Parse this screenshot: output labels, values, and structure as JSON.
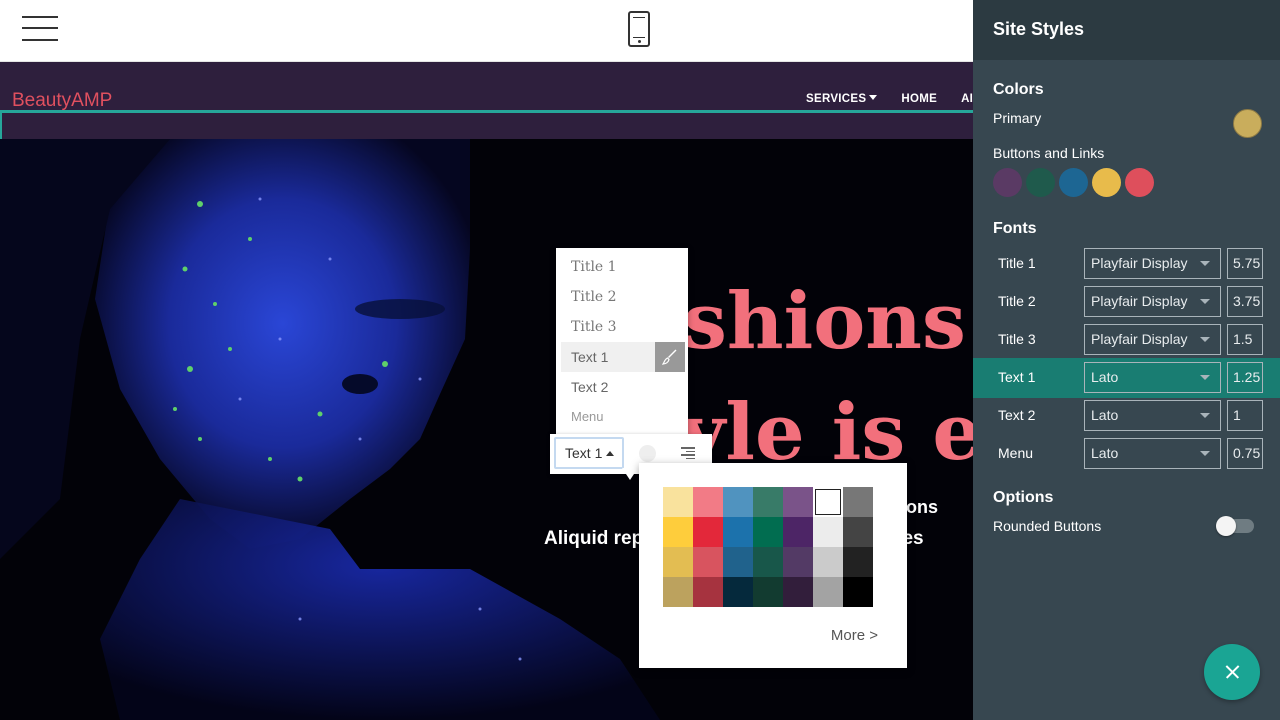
{
  "site": {
    "brand": "BeautyAMP",
    "nav": [
      "SERVICES",
      "HOME",
      "AI"
    ],
    "hero_line1": "shions",
    "hero_line2": "yle is ete",
    "hero_sub1": "et, cons",
    "hero_sub2": "Aliquid rep",
    "hero_sub2b": "dolores"
  },
  "style_menu": {
    "options": [
      "Title 1",
      "Title 2",
      "Title 3",
      "Text 1",
      "Text 2",
      "Menu"
    ],
    "selected": "Text 1"
  },
  "format_bar": {
    "style_label": "Text 1"
  },
  "color_picker": {
    "swatches": [
      "#f9e29d",
      "#f27b86",
      "#5093bf",
      "#387b68",
      "#7a5389",
      "#ffffff",
      "#777777",
      "#fecd3c",
      "#e3283a",
      "#1c72ac",
      "#016d50",
      "#4d2566",
      "#ececec",
      "#444444",
      "#e3bd52",
      "#d8545f",
      "#20628c",
      "#18574a",
      "#533a65",
      "#cbcbcb",
      "#222222",
      "#bca25e",
      "#a6333f",
      "#05293c",
      "#123b30",
      "#321e3b",
      "#a3a3a3",
      "#000000"
    ],
    "picked": "#ffffff",
    "more": "More >"
  },
  "panel": {
    "title": "Site Styles",
    "colors_title": "Colors",
    "primary_label": "Primary",
    "primary_color": "#c9ad5c",
    "buttons_label": "Buttons and Links",
    "button_colors": [
      "#5a3a64",
      "#1f5a4c",
      "#1d6693",
      "#e8bb4b",
      "#de4f5c"
    ],
    "fonts_title": "Fonts",
    "fonts": [
      {
        "label": "Title 1",
        "font": "Playfair Display",
        "size": "5.75"
      },
      {
        "label": "Title 2",
        "font": "Playfair Display",
        "size": "3.75"
      },
      {
        "label": "Title 3",
        "font": "Playfair Display",
        "size": "1.5"
      },
      {
        "label": "Text 1",
        "font": "Lato",
        "size": "1.25"
      },
      {
        "label": "Text 2",
        "font": "Lato",
        "size": "1"
      },
      {
        "label": "Menu",
        "font": "Lato",
        "size": "0.75"
      }
    ],
    "active_font": "Text 1",
    "options_title": "Options",
    "rounded_label": "Rounded Buttons",
    "rounded_on": false
  },
  "icons": {
    "menu": "hamburger-icon",
    "device": "phone-icon",
    "brush": "brush-icon",
    "align": "align-right-icon",
    "close": "close-icon"
  }
}
